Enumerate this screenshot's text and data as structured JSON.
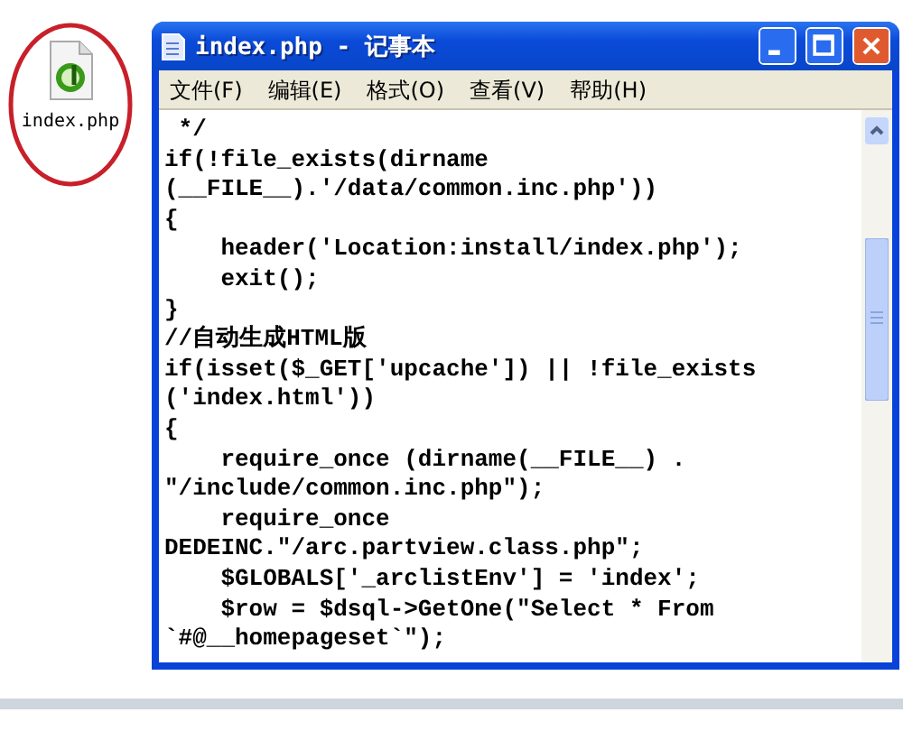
{
  "desktop_icon": {
    "label": "index.php",
    "circled": true
  },
  "window": {
    "title": "index.php - 记事本",
    "menu": [
      "文件(F)",
      "编辑(E)",
      "格式(O)",
      "查看(V)",
      "帮助(H)"
    ],
    "lines": [
      " */",
      "if(!file_exists(dirname",
      "(__FILE__).'/data/common.inc.php'))",
      "{",
      "    header('Location:install/index.php');",
      "    exit();",
      "}",
      "//自动生成HTML版",
      "if(isset($_GET['upcache']) || !file_exists",
      "('index.html'))",
      "{",
      "    require_once (dirname(__FILE__) .",
      "\"/include/common.inc.php\");",
      "    require_once",
      "DEDEINC.\"/arc.partview.class.php\";",
      "    $GLOBALS['_arclistEnv'] = 'index';",
      "    $row = $dsql->GetOne(\"Select * From",
      "`#@__homepageset`\");"
    ]
  }
}
